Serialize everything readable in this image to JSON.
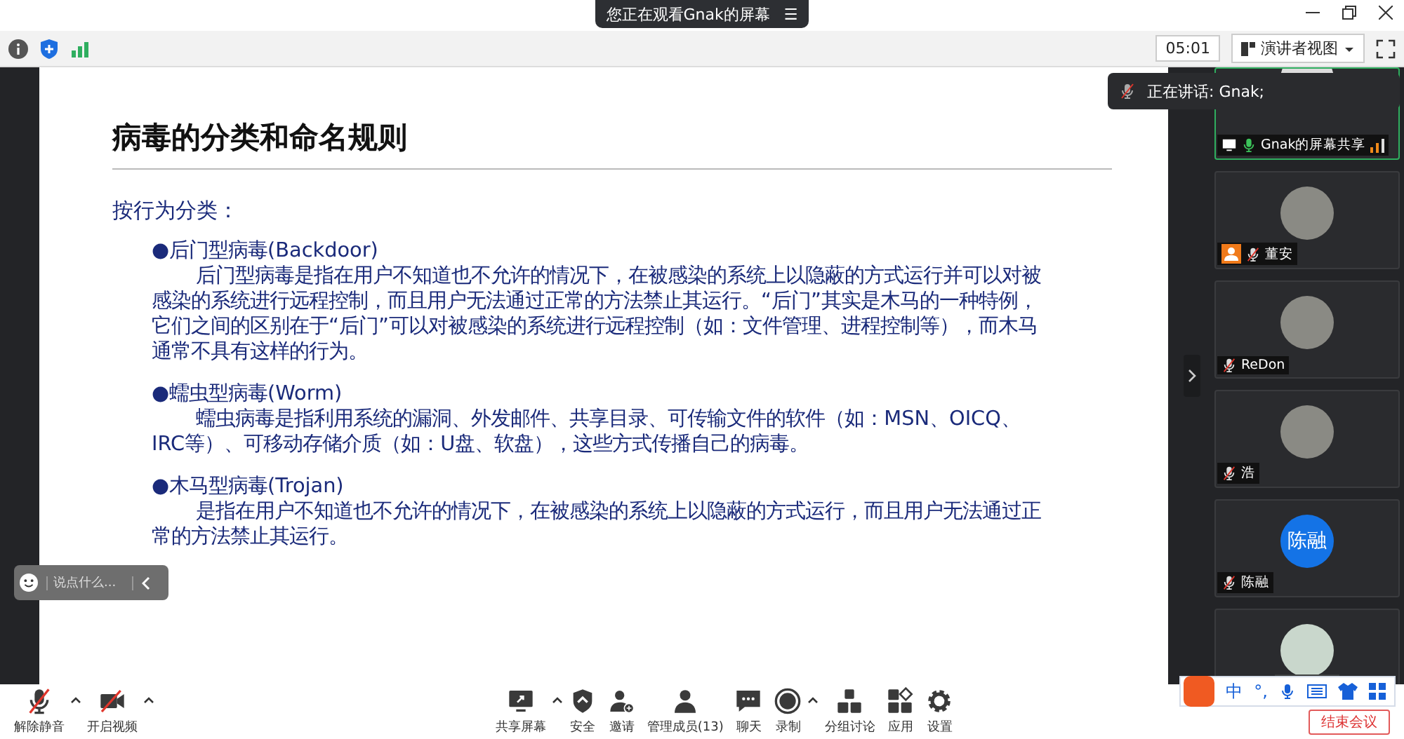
{
  "banner": {
    "title": "您正在观看Gnak的屏幕",
    "menu_glyph": "☰"
  },
  "top_bar": {
    "timer": "05:01",
    "view_button": "演讲者视图"
  },
  "slide": {
    "title": "病毒的分类和命名规则",
    "intro": "按行为分类：",
    "sections": [
      {
        "heading": "●后门型病毒(Backdoor)",
        "body": "后门型病毒是指在用户不知道也不允许的情况下，在被感染的系统上以隐蔽的方式运行并可以对被感染的系统进行远程控制，而且用户无法通过正常的方法禁止其运行。“后门”其实是木马的一种特例，它们之间的区别在于“后门”可以对被感染的系统进行远程控制（如：文件管理、进程控制等），而木马通常不具有这样的行为。"
      },
      {
        "heading": "●蠕虫型病毒(Worm)",
        "body": "蠕虫病毒是指利用系统的漏洞、外发邮件、共享目录、可传输文件的软件（如：MSN、OICQ、IRC等）、可移动存储介质（如：U盘、软盘），这些方式传播自己的病毒。"
      },
      {
        "heading": "●木马型病毒(Trojan)",
        "body": "是指在用户不知道也不允许的情况下，在被感染的系统上以隐蔽的方式运行，而且用户无法通过正常的方法禁止其运行。"
      }
    ]
  },
  "speaking_indicator": {
    "text": "正在讲话: Gnak;"
  },
  "participants": [
    {
      "kind": "screen_share",
      "name": "Gnak的屏幕共享",
      "muted": false,
      "speaking": true
    },
    {
      "kind": "photo",
      "name": "董安",
      "muted": true,
      "speaking": false,
      "host": true
    },
    {
      "kind": "photo",
      "name": "ReDon",
      "muted": true,
      "speaking": false,
      "host": false
    },
    {
      "kind": "photo",
      "name": "浩",
      "muted": true,
      "speaking": false,
      "host": false
    },
    {
      "kind": "initials",
      "avatar_text": "陈融",
      "name": "陈融",
      "muted": true,
      "speaking": false,
      "host": false
    },
    {
      "kind": "partial"
    }
  ],
  "chat_input": {
    "placeholder": "说点什么..."
  },
  "toolbar_left": [
    {
      "kind": "mic",
      "label": "解除静音",
      "off": true,
      "menu": true
    },
    {
      "kind": "video",
      "label": "开启视频",
      "off": true,
      "menu": true
    }
  ],
  "toolbar_center": [
    {
      "kind": "share",
      "label": "共享屏幕",
      "menu": true
    },
    {
      "kind": "shield",
      "label": "安全",
      "menu": false
    },
    {
      "kind": "invite",
      "label": "邀请",
      "menu": false
    },
    {
      "kind": "members",
      "label": "管理成员(13)",
      "menu": false
    },
    {
      "kind": "chat",
      "label": "聊天",
      "menu": false
    },
    {
      "kind": "record",
      "label": "录制",
      "menu": true
    },
    {
      "kind": "breakout",
      "label": "分组讨论",
      "menu": false
    },
    {
      "kind": "apps",
      "label": "应用",
      "menu": false
    },
    {
      "kind": "settings",
      "label": "设置",
      "menu": false
    }
  ],
  "end_button": "结束会议",
  "ime_toolbar": {
    "mode": "中",
    "punctuation": "°,"
  }
}
